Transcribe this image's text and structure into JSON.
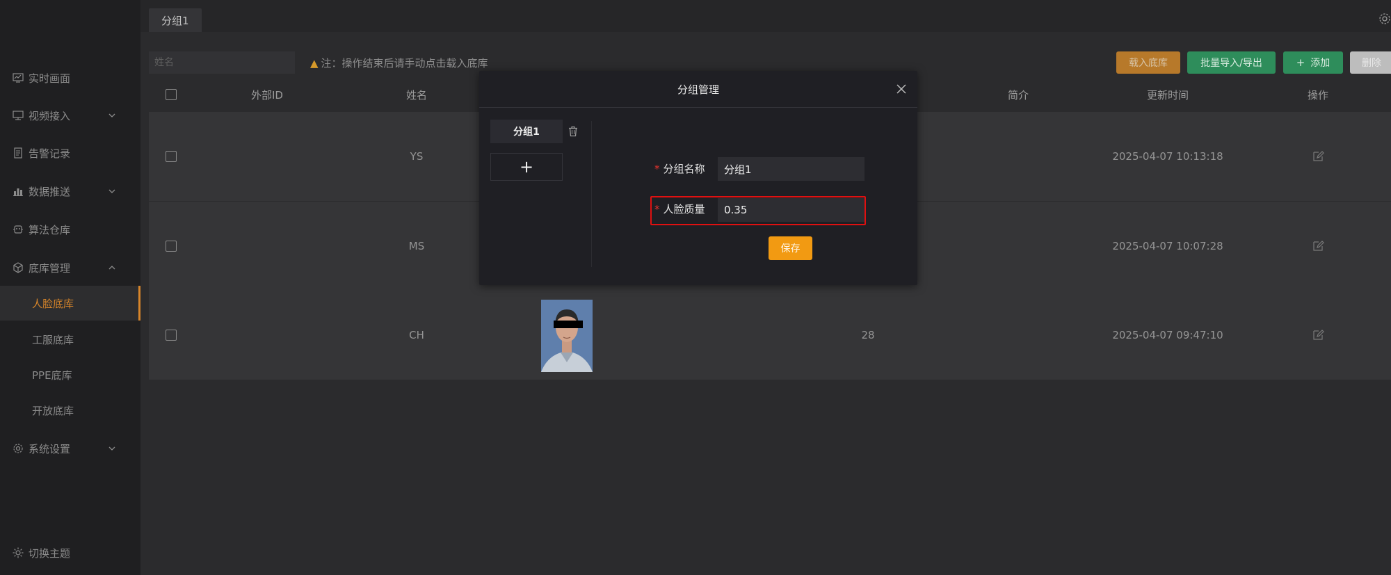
{
  "sidebar": {
    "items": [
      {
        "label": "实时画面",
        "icon": "monitor-chart-icon"
      },
      {
        "label": "视频接入",
        "icon": "display-icon",
        "expandable": true
      },
      {
        "label": "告警记录",
        "icon": "document-icon"
      },
      {
        "label": "数据推送",
        "icon": "bar-chart-icon",
        "expandable": true
      },
      {
        "label": "算法仓库",
        "icon": "algorithm-icon"
      },
      {
        "label": "底库管理",
        "icon": "cube-icon",
        "expanded": true
      }
    ],
    "sub_items": [
      "人脸底库",
      "工服底库",
      "PPE底库",
      "开放底库"
    ],
    "active_sub": "人脸底库",
    "settings": {
      "label": "系统设置",
      "icon": "gear-icon"
    },
    "theme_toggle": {
      "label": "切换主题",
      "icon": "sun-icon"
    }
  },
  "tabs": [
    {
      "label": "分组1"
    }
  ],
  "toolbar": {
    "search_placeholder": "姓名",
    "notice": "注：操作结束后请手动点击载入底库",
    "buttons": {
      "load": "载入底库",
      "batch": "批量导入/导出",
      "add": "添加",
      "delete": "删除"
    }
  },
  "table": {
    "headers": [
      "外部ID",
      "姓名",
      "简介",
      "更新时间",
      "操作"
    ],
    "rows": [
      {
        "name": "YS",
        "intro": "",
        "updated": "2025-04-07 10:13:18"
      },
      {
        "name": "MS",
        "intro": "",
        "updated": "2025-04-07 10:07:28"
      },
      {
        "name": "CH",
        "intro": "28",
        "updated": "2025-04-07 09:47:10"
      }
    ]
  },
  "modal": {
    "title": "分组管理",
    "groups": [
      "分组1"
    ],
    "add_symbol": "+",
    "form": {
      "group_name_label": "分组名称",
      "group_name_value": "分组1",
      "face_quality_label": "人脸质量",
      "face_quality_value": "0.35",
      "required_mark": "*"
    },
    "save_label": "保存"
  },
  "colors": {
    "accent_orange": "#f29a12",
    "active_nav": "#d7852a",
    "green": "#2e8d5b",
    "highlight_red": "#e01010"
  }
}
